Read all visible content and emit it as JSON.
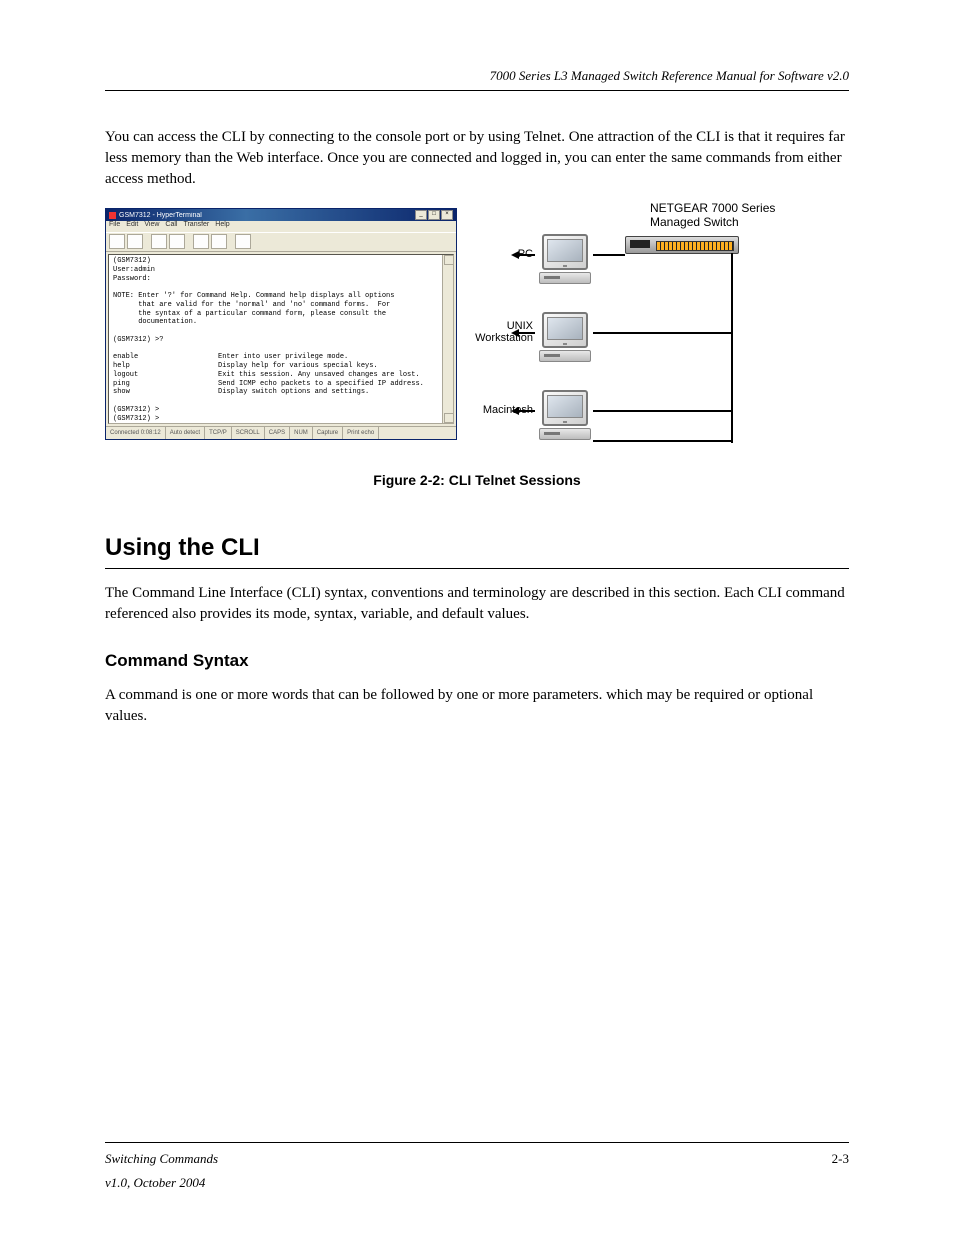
{
  "header": {
    "running": "7000 Series L3 Managed Switch Reference Manual for Software v2.0"
  },
  "intro_para": "You can access the CLI by connecting to the console port or by using Telnet. One attraction of the CLI is that it requires far less memory than the Web interface. Once you are connected and logged in, you can enter the same commands from either access method.",
  "figure": {
    "win": {
      "title": "GSM7312 - HyperTerminal",
      "menu": [
        "File",
        "Edit",
        "View",
        "Call",
        "Transfer",
        "Help"
      ],
      "terminal_text": "(GSM7312)\nUser:admin\nPassword:\n\nNOTE: Enter '?' for Command Help. Command help displays all options\n      that are valid for the 'normal' and 'no' command forms.  For\n      the syntax of a particular command form, please consult the\n      documentation.\n\n(GSM7312) >?\n\nenable                   Enter into user privilege mode.\nhelp                     Display help for various special keys.\nlogout                   Exit this session. Any unsaved changes are lost.\nping                     Send ICMP echo packets to a specified IP address.\nshow                     Display switch options and settings.\n\n(GSM7312) >\n(GSM7312) >",
      "status": [
        "Connected 0:08:12",
        "Auto detect",
        "TCP/P",
        "SCROLL",
        "CAPS",
        "NUM",
        "Capture",
        "Print echo"
      ],
      "ctrl_min": "_",
      "ctrl_max": "□",
      "ctrl_close": "×"
    },
    "diagram": {
      "switch_label": "NETGEAR 7000 Series Managed Switch",
      "nodes": [
        {
          "label": "PC"
        },
        {
          "label": "UNIX Workstation"
        },
        {
          "label": "Macintosh"
        }
      ]
    },
    "caption": "Figure 2-2:  CLI Telnet Sessions"
  },
  "section": {
    "title": "Using the CLI",
    "para1": "The Command Line Interface (CLI) syntax, conventions and terminology are described in this section. Each CLI command referenced also provides its mode, syntax, variable, and default values.",
    "sub": "Command Syntax",
    "para2": "A command is one or more words that can be followed by one or more parameters. which may be required or optional values."
  },
  "footer": {
    "left": "Switching Commands",
    "right": "2-3",
    "version": "v1.0, October 2004"
  }
}
